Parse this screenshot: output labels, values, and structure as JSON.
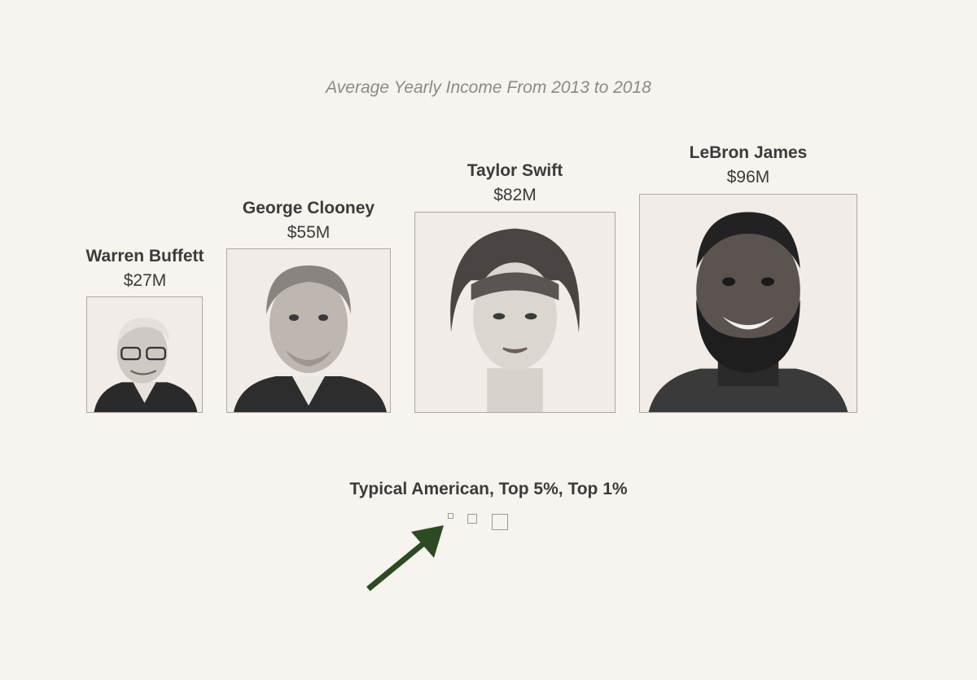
{
  "subtitle": "Average Yearly Income From 2013 to 2018",
  "chart_data": {
    "type": "bar",
    "title": "",
    "subtitle": "Average Yearly Income From 2013 to 2018",
    "categories": [
      "Warren Buffett",
      "George Clooney",
      "Taylor Swift",
      "LeBron James"
    ],
    "values": [
      27,
      55,
      82,
      96
    ],
    "value_labels": [
      "$27M",
      "$55M",
      "$82M",
      "$96M"
    ],
    "unit": "$M",
    "encoding": "area of square portrait proportional to value",
    "comparison": {
      "label": "Typical American, Top 5%, Top 1%",
      "categories": [
        "Typical American",
        "Top 5%",
        "Top 1%"
      ]
    },
    "colors": {
      "background": "#f7f3ee",
      "arrow": "#2e4a24",
      "border": "#a9a9a9"
    }
  },
  "people": [
    {
      "name": "Warren Buffett",
      "value": "$27M"
    },
    {
      "name": "George Clooney",
      "value": "$55M"
    },
    {
      "name": "Taylor Swift",
      "value": "$82M"
    },
    {
      "name": "LeBron James",
      "value": "$96M"
    }
  ],
  "comparison_label": "Typical American, Top 5%, Top 1%",
  "icons": {
    "arrow": "arrow-up-right-icon"
  }
}
